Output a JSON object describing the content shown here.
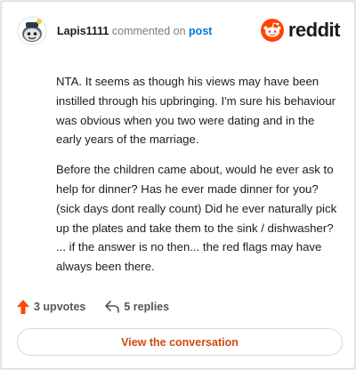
{
  "header": {
    "username": "Lapis1111",
    "commented_text": "commented on",
    "post_link": "post",
    "brand_name": "reddit"
  },
  "comment": {
    "paragraphs": [
      "NTA. It seems as though his views may have been instilled through his upbringing. I'm sure his behaviour was obvious when you two were dating and in the early years of the marriage.",
      "Before the children came about, would he ever ask to help for dinner? Has he ever made dinner for you? (sick days dont really count) Did he ever naturally pick up the plates and take them to the sink / dishwasher? ... if the answer is no then... the red flags may have always been there."
    ]
  },
  "actions": {
    "upvotes": "3 upvotes",
    "replies": "5 replies"
  },
  "footer": {
    "view_label": "View the conversation"
  },
  "colors": {
    "brand": "#ff4500",
    "link": "#0079d3",
    "cta": "#cc4b12"
  },
  "icons": {
    "avatar": "snoo-avatar",
    "brand": "reddit-logo-icon",
    "upvote": "upvote-arrow-icon",
    "reply": "reply-arrow-icon"
  }
}
